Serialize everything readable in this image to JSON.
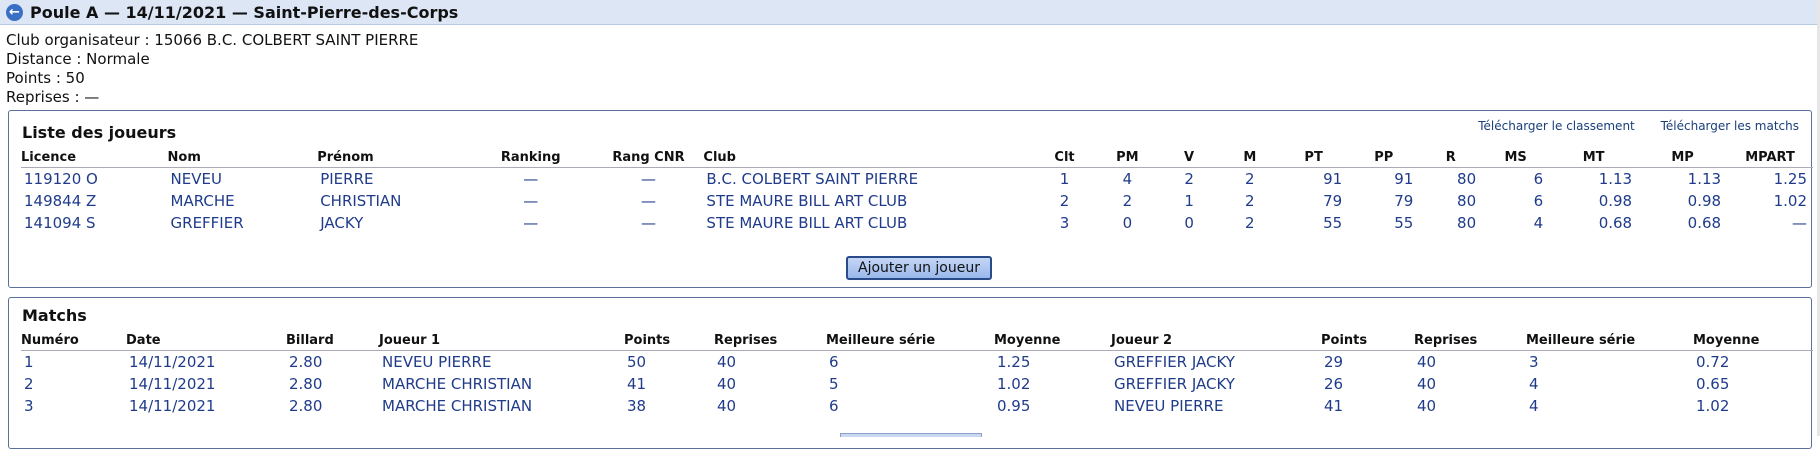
{
  "header": {
    "back_icon": "back-arrow-icon",
    "title": "Poule A — 14/11/2021 — Saint-Pierre-des-Corps"
  },
  "info": {
    "club": "Club organisateur : 15066 B.C. COLBERT SAINT PIERRE",
    "distance": "Distance : Normale",
    "points": "Points : 50",
    "reprises": "Reprises : —"
  },
  "players": {
    "title": "Liste des joueurs",
    "download_ranking": "Télécharger le classement",
    "download_matches": "Télécharger les matchs",
    "columns": [
      "Licence",
      "Nom",
      "Prénom",
      "Ranking",
      "Rang CNR",
      "Club",
      "Clt",
      "PM",
      "V",
      "M",
      "PT",
      "PP",
      "R",
      "MS",
      "MT",
      "MP",
      "MPART"
    ],
    "rows": [
      [
        "119120 O",
        "NEVEU",
        "PIERRE",
        "—",
        "—",
        "B.C. COLBERT SAINT PIERRE",
        "1",
        "4",
        "2",
        "2",
        "91",
        "91",
        "80",
        "6",
        "1.13",
        "1.13",
        "1.25"
      ],
      [
        "149844 Z",
        "MARCHE",
        "CHRISTIAN",
        "—",
        "—",
        "STE MAURE BILL ART CLUB",
        "2",
        "2",
        "1",
        "2",
        "79",
        "79",
        "80",
        "6",
        "0.98",
        "0.98",
        "1.02"
      ],
      [
        "141094 S",
        "GREFFIER",
        "JACKY",
        "—",
        "—",
        "STE MAURE BILL ART CLUB",
        "3",
        "0",
        "0",
        "2",
        "55",
        "55",
        "80",
        "4",
        "0.68",
        "0.68",
        "—"
      ]
    ],
    "add_button": "Ajouter un joueur"
  },
  "matches": {
    "title": "Matchs",
    "columns": [
      "Numéro",
      "Date",
      "Billard",
      "Joueur 1",
      "Points",
      "Reprises",
      "Meilleure série",
      "Moyenne",
      "Joueur 2",
      "Points",
      "Reprises",
      "Meilleure série",
      "Moyenne"
    ],
    "rows": [
      [
        "1",
        "14/11/2021",
        "2.80",
        "NEVEU PIERRE",
        "50",
        "40",
        "6",
        "1.25",
        "GREFFIER JACKY",
        "29",
        "40",
        "3",
        "0.72"
      ],
      [
        "2",
        "14/11/2021",
        "2.80",
        "MARCHE CHRISTIAN",
        "41",
        "40",
        "5",
        "1.02",
        "GREFFIER JACKY",
        "26",
        "40",
        "4",
        "0.65"
      ],
      [
        "3",
        "14/11/2021",
        "2.80",
        "MARCHE CHRISTIAN",
        "38",
        "40",
        "6",
        "0.95",
        "NEVEU PIERRE",
        "41",
        "40",
        "4",
        "1.02"
      ]
    ]
  }
}
